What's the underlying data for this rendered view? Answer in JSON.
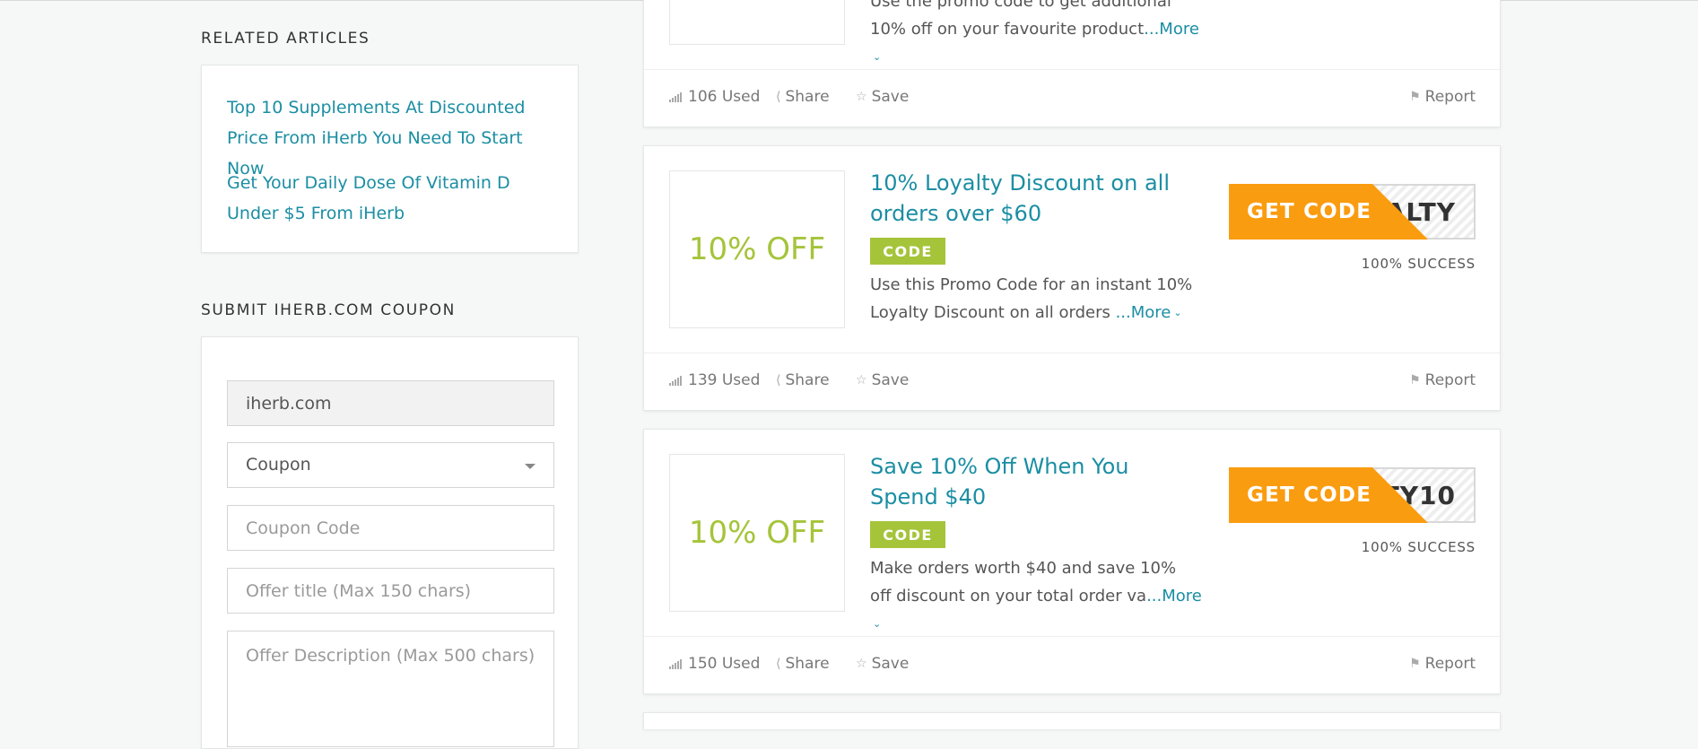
{
  "sidebar": {
    "related_title": "RELATED ARTICLES",
    "articles": [
      {
        "title": "Top 10 Supplements At Discounted Price From iHerb You Need To Start Now"
      },
      {
        "title": "Get Your Daily Dose Of Vitamin D Under $5 From iHerb"
      }
    ],
    "submit_title": "SUBMIT IHERB.COM COUPON",
    "form": {
      "store_value": "iherb.com",
      "type_selected": "Coupon",
      "code_placeholder": "Coupon Code",
      "title_placeholder": "Offer title (Max 150 chars)",
      "desc_placeholder": "Offer Description (Max 500 chars)"
    }
  },
  "coupons": [
    {
      "desc_text": "Use the promo code to get additional 10% off on your favourite product",
      "more_label": "...More",
      "used": "106 Used",
      "share": "Share",
      "save": "Save",
      "report": "Report"
    },
    {
      "discount": "10% OFF",
      "title": "10% Loyalty Discount on all orders over $60",
      "badge": "CODE",
      "desc_text": "Use this Promo Code for an instant 10% Loyalty Discount on all orders ",
      "more_label": "...More",
      "button_label": "GET CODE",
      "code_fragment": "ALTY",
      "success": "100% SUCCESS",
      "used": "139 Used",
      "share": "Share",
      "save": "Save",
      "report": "Report"
    },
    {
      "discount": "10% OFF",
      "title": "Save 10% Off When You Spend $40",
      "badge": "CODE",
      "desc_text": "Make orders worth $40 and save 10% off discount on your total order va",
      "more_label": "...More",
      "button_label": "GET CODE",
      "code_fragment": "TY10",
      "success": "100% SUCCESS",
      "used": "150 Used",
      "share": "Share",
      "save": "Save",
      "report": "Report"
    }
  ],
  "icons": {
    "signal": "signal-bars-icon",
    "share": "share-icon",
    "save": "star-outline-icon",
    "report": "flag-icon",
    "more": "chevron-down-icon",
    "select": "caret-down-icon"
  },
  "colors": {
    "link": "#1b8ea3",
    "discount_green": "#a5c43a",
    "button_orange": "#fa9c10",
    "background": "#f6f7f7"
  }
}
